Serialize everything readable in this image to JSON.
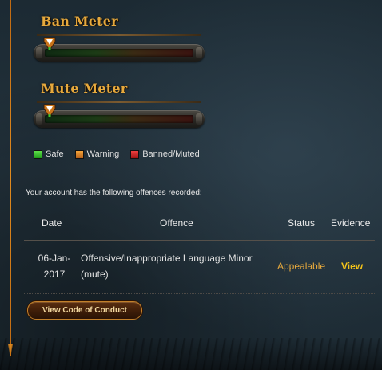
{
  "ban_meter": {
    "title": "Ban Meter",
    "level": 0
  },
  "mute_meter": {
    "title": "Mute Meter",
    "level": 0
  },
  "legend": [
    {
      "label": "Safe",
      "color": "#3cc832"
    },
    {
      "label": "Warning",
      "color": "#e8902a"
    },
    {
      "label": "Banned/Muted",
      "color": "#d82828"
    }
  ],
  "offences": {
    "intro": "Your account has the following offences recorded:",
    "headers": {
      "date": "Date",
      "offence": "Offence",
      "status": "Status",
      "evidence": "Evidence"
    },
    "rows": [
      {
        "date_line1": "06-Jan-",
        "date_line2": "2017",
        "offence_line1": "Offensive/Inappropriate Language Minor",
        "offence_line2": "(mute)",
        "status": "Appealable",
        "evidence": "View"
      }
    ]
  },
  "code_button": {
    "label": "View Code of Conduct"
  },
  "colors": {
    "accent": "#e6a93d",
    "link": "#f3c31a",
    "side_line": "#e08a1e"
  }
}
